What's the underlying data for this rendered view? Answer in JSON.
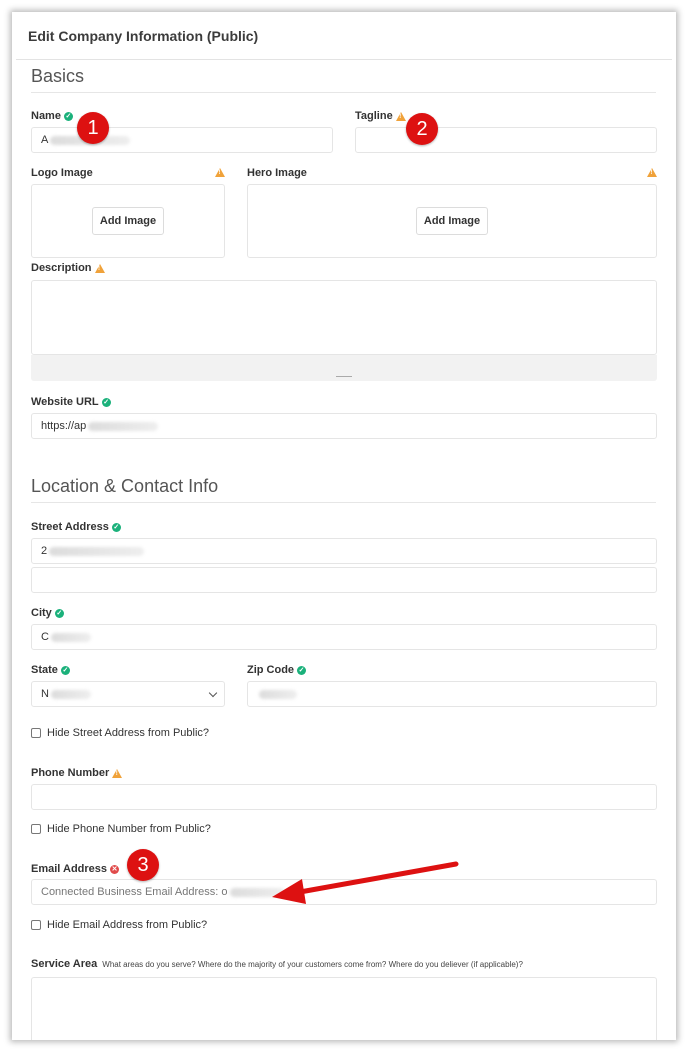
{
  "header": {
    "title": "Edit Company Information (Public)"
  },
  "sections": {
    "basics": "Basics",
    "location": "Location & Contact Info"
  },
  "fields": {
    "name": {
      "label": "Name",
      "value": "A",
      "status": "ok"
    },
    "tagline": {
      "label": "Tagline",
      "value": "",
      "status": "warning"
    },
    "logo": {
      "label": "Logo Image",
      "button": "Add Image",
      "status": "warning"
    },
    "hero": {
      "label": "Hero Image",
      "button": "Add Image",
      "status": "warning"
    },
    "description": {
      "label": "Description",
      "status": "warning"
    },
    "website": {
      "label": "Website URL",
      "value": "https://ap",
      "status": "ok"
    },
    "street": {
      "label": "Street Address",
      "value": "2",
      "line2": "",
      "status": "ok"
    },
    "city": {
      "label": "City",
      "value": "C",
      "status": "ok"
    },
    "state": {
      "label": "State",
      "value": "N",
      "status": "ok"
    },
    "zip": {
      "label": "Zip Code",
      "value": "",
      "status": "ok"
    },
    "hide_street": {
      "label": "Hide Street Address from Public?",
      "checked": false
    },
    "phone": {
      "label": "Phone Number",
      "value": "",
      "status": "warning"
    },
    "hide_phone": {
      "label": "Hide Phone Number from Public?",
      "checked": false
    },
    "email": {
      "label": "Email Address",
      "placeholder": "Connected Business Email Address: o",
      "status": "error"
    },
    "hide_email": {
      "label": "Hide Email Address from Public?",
      "checked": false
    },
    "service_area": {
      "label": "Service Area",
      "hint": "What areas do you serve? Where do the majority of your customers come from? Where do you deliever (if applicable)?"
    }
  },
  "annotations": {
    "badge1": "1",
    "badge2": "2",
    "badge3": "3",
    "color": "#dd1111"
  },
  "colors": {
    "ok": "#1bb17b",
    "warning": "#f0a23a",
    "error": "#e04a4a"
  }
}
